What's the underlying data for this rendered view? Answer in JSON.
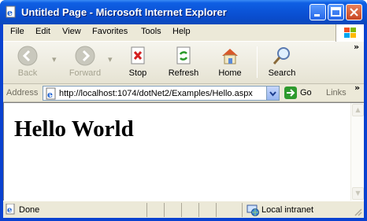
{
  "window": {
    "title": "Untitled Page - Microsoft Internet Explorer"
  },
  "menu": [
    "File",
    "Edit",
    "View",
    "Favorites",
    "Tools",
    "Help"
  ],
  "toolbar": {
    "back": "Back",
    "forward": "Forward",
    "stop": "Stop",
    "refresh": "Refresh",
    "home": "Home",
    "search": "Search",
    "overflow": "»"
  },
  "address": {
    "label": "Address",
    "url": "http://localhost:1074/dotNet2/Examples/Hello.aspx",
    "go": "Go",
    "links": "Links",
    "links_overflow": "»"
  },
  "page": {
    "heading": "Hello World"
  },
  "status": {
    "text": "Done",
    "zone": "Local intranet"
  },
  "colors": {
    "titlebar": "#0b54d8",
    "chrome": "#ece9d8",
    "go_green": "#2e9a2e"
  }
}
